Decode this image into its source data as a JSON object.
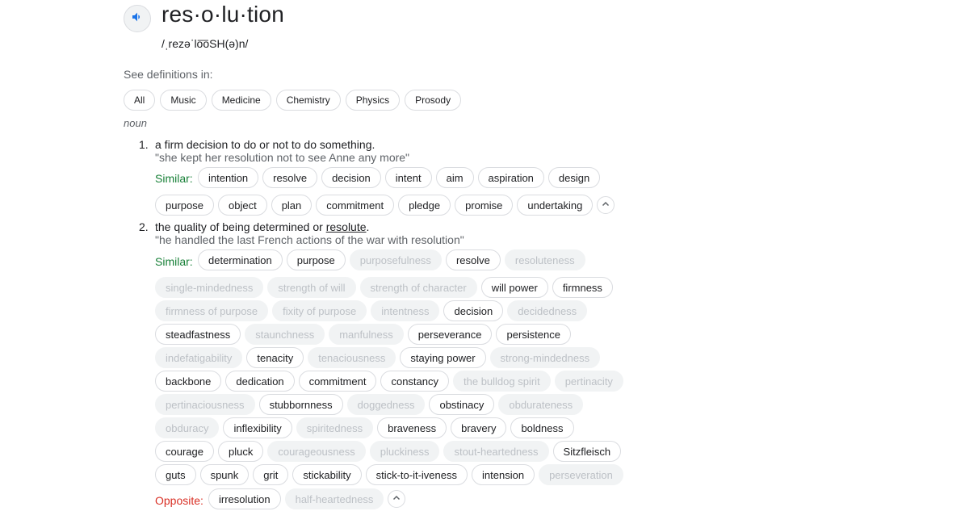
{
  "word": "res·o·lu·tion",
  "phonetic": "/ˌrezəˈlo͞oSH(ə)n/",
  "see_definitions_label": "See definitions in:",
  "categories": [
    "All",
    "Music",
    "Medicine",
    "Chemistry",
    "Physics",
    "Prosody"
  ],
  "part_of_speech": "noun",
  "similar_label": "Similar:",
  "opposite_label": "Opposite:",
  "sense1": {
    "number": "1.",
    "definition": "a firm decision to do or not to do something.",
    "example": "\"she kept her resolution not to see Anne any more\"",
    "similar_rows": [
      [
        {
          "word": "intention",
          "muted": false
        },
        {
          "word": "resolve",
          "muted": false
        },
        {
          "word": "decision",
          "muted": false
        },
        {
          "word": "intent",
          "muted": false
        },
        {
          "word": "aim",
          "muted": false
        },
        {
          "word": "aspiration",
          "muted": false
        },
        {
          "word": "design",
          "muted": false
        }
      ],
      [
        {
          "word": "purpose",
          "muted": false
        },
        {
          "word": "object",
          "muted": false
        },
        {
          "word": "plan",
          "muted": false
        },
        {
          "word": "commitment",
          "muted": false
        },
        {
          "word": "pledge",
          "muted": false
        },
        {
          "word": "promise",
          "muted": false
        },
        {
          "word": "undertaking",
          "muted": false
        }
      ]
    ]
  },
  "sense2": {
    "number": "2.",
    "definition_prefix": "the quality of being determined or ",
    "definition_link": "resolute",
    "definition_suffix": ".",
    "example": "\"he handled the last French actions of the war with resolution\"",
    "similar_rows": [
      [
        {
          "word": "determination",
          "muted": false
        },
        {
          "word": "purpose",
          "muted": false
        },
        {
          "word": "purposefulness",
          "muted": true
        },
        {
          "word": "resolve",
          "muted": false
        },
        {
          "word": "resoluteness",
          "muted": true
        }
      ],
      [
        {
          "word": "single-mindedness",
          "muted": true
        },
        {
          "word": "strength of will",
          "muted": true
        },
        {
          "word": "strength of character",
          "muted": true
        },
        {
          "word": "will power",
          "muted": false
        },
        {
          "word": "firmness",
          "muted": false
        }
      ],
      [
        {
          "word": "firmness of purpose",
          "muted": true
        },
        {
          "word": "fixity of purpose",
          "muted": true
        },
        {
          "word": "intentness",
          "muted": true
        },
        {
          "word": "decision",
          "muted": false
        },
        {
          "word": "decidedness",
          "muted": true
        }
      ],
      [
        {
          "word": "steadfastness",
          "muted": false
        },
        {
          "word": "staunchness",
          "muted": true
        },
        {
          "word": "manfulness",
          "muted": true
        },
        {
          "word": "perseverance",
          "muted": false
        },
        {
          "word": "persistence",
          "muted": false
        }
      ],
      [
        {
          "word": "indefatigability",
          "muted": true
        },
        {
          "word": "tenacity",
          "muted": false
        },
        {
          "word": "tenaciousness",
          "muted": true
        },
        {
          "word": "staying power",
          "muted": false
        },
        {
          "word": "strong-mindedness",
          "muted": true
        }
      ],
      [
        {
          "word": "backbone",
          "muted": false
        },
        {
          "word": "dedication",
          "muted": false
        },
        {
          "word": "commitment",
          "muted": false
        },
        {
          "word": "constancy",
          "muted": false
        },
        {
          "word": "the bulldog spirit",
          "muted": true
        },
        {
          "word": "pertinacity",
          "muted": true
        }
      ],
      [
        {
          "word": "pertinaciousness",
          "muted": true
        },
        {
          "word": "stubbornness",
          "muted": false
        },
        {
          "word": "doggedness",
          "muted": true
        },
        {
          "word": "obstinacy",
          "muted": false
        },
        {
          "word": "obdurateness",
          "muted": true
        }
      ],
      [
        {
          "word": "obduracy",
          "muted": true
        },
        {
          "word": "inflexibility",
          "muted": false
        },
        {
          "word": "spiritedness",
          "muted": true
        },
        {
          "word": "braveness",
          "muted": false
        },
        {
          "word": "bravery",
          "muted": false
        },
        {
          "word": "boldness",
          "muted": false
        }
      ],
      [
        {
          "word": "courage",
          "muted": false
        },
        {
          "word": "pluck",
          "muted": false
        },
        {
          "word": "courageousness",
          "muted": true
        },
        {
          "word": "pluckiness",
          "muted": true
        },
        {
          "word": "stout-heartedness",
          "muted": true
        },
        {
          "word": "Sitzfleisch",
          "muted": false
        }
      ],
      [
        {
          "word": "guts",
          "muted": false
        },
        {
          "word": "spunk",
          "muted": false
        },
        {
          "word": "grit",
          "muted": false
        },
        {
          "word": "stickability",
          "muted": false
        },
        {
          "word": "stick-to-it-iveness",
          "muted": false
        },
        {
          "word": "intension",
          "muted": false
        },
        {
          "word": "perseveration",
          "muted": true
        }
      ]
    ],
    "opposite_row": [
      {
        "word": "irresolution",
        "muted": false
      },
      {
        "word": "half-heartedness",
        "muted": true
      }
    ]
  },
  "colors": {
    "similar": "#188038",
    "opposite": "#d93025",
    "chip_border": "#dadce0",
    "muted_text": "#bdc1c6",
    "speaker_icon": "#1a73e8"
  },
  "icons": {
    "speaker": "speaker-icon",
    "collapse": "chevron-up-icon"
  }
}
